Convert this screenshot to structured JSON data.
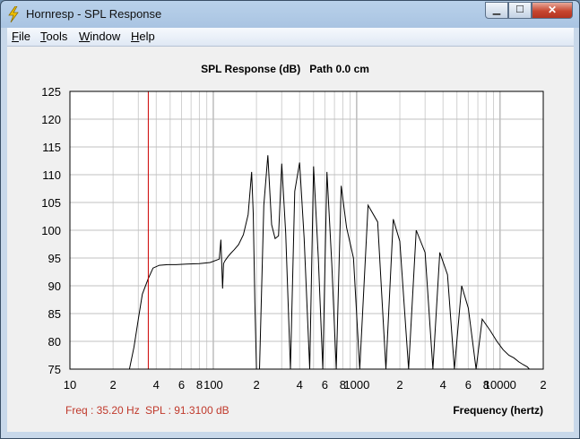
{
  "window": {
    "title": "Hornresp - SPL Response",
    "minimize_glyph": "▁",
    "maximize_glyph": "☐",
    "close_glyph": "✕",
    "app_icon": "lightning-bolt-icon"
  },
  "menu": [
    "File",
    "Tools",
    "Window",
    "Help"
  ],
  "status": {
    "freq": "Freq : 35.20 Hz",
    "spl": "SPL : 91.3100 dB"
  },
  "colors": {
    "cursor": "#cc0000",
    "status_text": "#c0392b"
  },
  "chart_data": {
    "type": "line",
    "title": "SPL Response (dB)   Path 0.0 cm",
    "xlabel": "Frequency (hertz)",
    "ylabel": "",
    "xscale": "log",
    "xlim": [
      10,
      20000
    ],
    "ylim": [
      75,
      125
    ],
    "ytick_labels": [
      "125",
      "120",
      "115",
      "110",
      "105",
      "100",
      "95",
      "90",
      "85",
      "80",
      "75"
    ],
    "xtick_labels": [
      "10",
      "2",
      "4",
      "6",
      "8",
      "100",
      "2",
      "4",
      "6",
      "8",
      "1000",
      "2",
      "4",
      "6",
      "8",
      "10000",
      "2"
    ],
    "cursor_x": 35.2,
    "grid": true,
    "series": [
      {
        "values_note": "",
        "x": [
          26,
          28,
          30,
          32,
          35.2,
          38,
          42,
          48,
          55,
          65,
          80,
          95,
          110,
          113,
          116,
          118,
          120,
          122,
          126,
          132,
          140,
          150,
          162,
          175,
          185,
          190,
          195,
          200,
          210,
          225,
          240,
          255,
          270,
          285,
          300,
          320,
          345,
          370,
          400,
          430,
          470,
          500,
          540,
          580,
          620,
          670,
          720,
          780,
          850,
          950,
          1050,
          1200,
          1400,
          1600,
          1800,
          2000,
          2300,
          2600,
          3000,
          3400,
          3800,
          4300,
          4800,
          5400,
          6000,
          6800,
          7500,
          8500,
          9500,
          10500,
          11500,
          12500,
          13500,
          14500,
          15500,
          16000
        ],
        "y": [
          75,
          79,
          84,
          88.5,
          91.3,
          93.2,
          93.7,
          93.8,
          93.8,
          93.9,
          94.0,
          94.2,
          94.8,
          98.3,
          89.5,
          94.0,
          94.4,
          94.7,
          95.2,
          95.8,
          96.5,
          97.4,
          99.2,
          102.8,
          110.5,
          103.0,
          87.0,
          75,
          75,
          104.5,
          113.5,
          101.0,
          98.5,
          99.0,
          112.0,
          99.5,
          75,
          107.0,
          112.2,
          98.5,
          75,
          111.5,
          95.0,
          75,
          110.5,
          94.0,
          75,
          108.0,
          100.5,
          95.0,
          75,
          104.5,
          101.5,
          75,
          102.0,
          98.0,
          75,
          100.0,
          96.0,
          75,
          96.0,
          92.0,
          75,
          90.0,
          86.0,
          75,
          84.0,
          82.0,
          80.0,
          78.5,
          77.5,
          77.0,
          76.3,
          75.8,
          75.4,
          75.0
        ]
      }
    ]
  }
}
